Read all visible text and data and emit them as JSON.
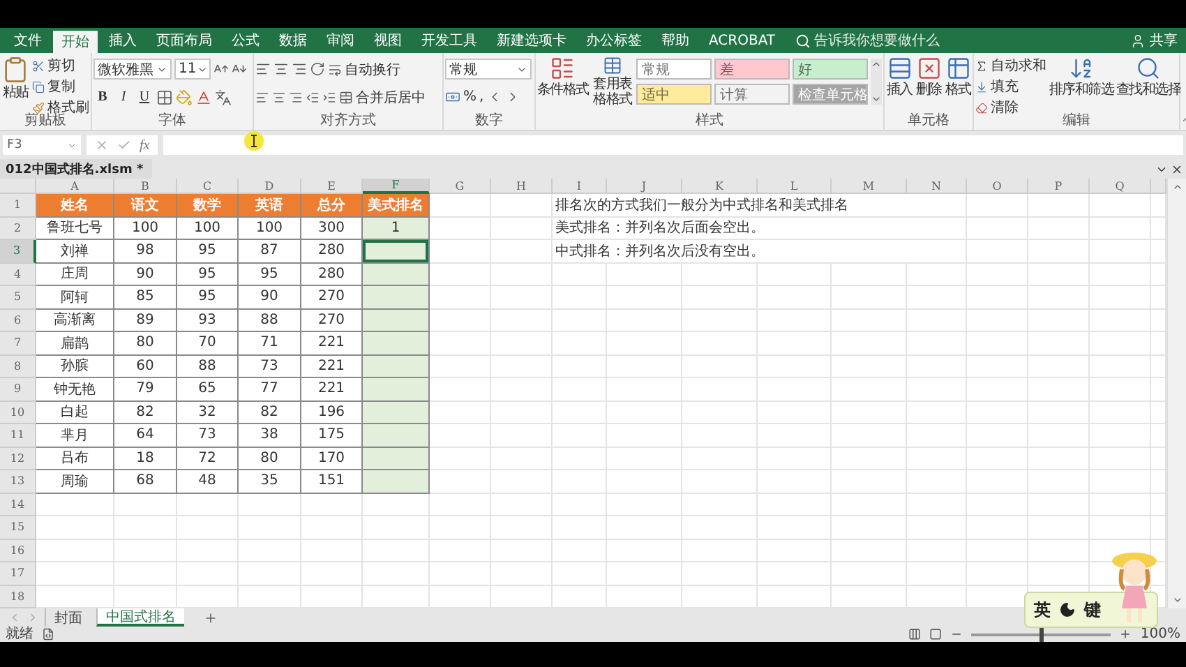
{
  "ribbon_tabs": [
    {
      "label": "文件",
      "selected": false
    },
    {
      "label": "开始",
      "selected": true
    },
    {
      "label": "插入",
      "selected": false
    },
    {
      "label": "页面布局",
      "selected": false
    },
    {
      "label": "公式",
      "selected": false
    },
    {
      "label": "数据",
      "selected": false
    },
    {
      "label": "审阅",
      "selected": false
    },
    {
      "label": "视图",
      "selected": false
    },
    {
      "label": "开发工具",
      "selected": false
    },
    {
      "label": "新建选项卡",
      "selected": false
    },
    {
      "label": "办公标签",
      "selected": false
    },
    {
      "label": "帮助",
      "selected": false
    },
    {
      "label": "ACROBAT",
      "selected": false
    }
  ],
  "tell_me": {
    "placeholder": "告诉我你想要做什么"
  },
  "share": "共享",
  "ribbon": {
    "clipboard": {
      "paste": "粘贴",
      "cut": "剪切",
      "copy": "复制",
      "format_painter": "格式刷",
      "label": "剪贴板"
    },
    "font": {
      "name": "微软雅黑",
      "size": "11",
      "bold": "B",
      "italic": "I",
      "underline": "U",
      "label": "字体"
    },
    "alignment": {
      "wrap": "自动换行",
      "merge": "合并后居中",
      "label": "对齐方式"
    },
    "number": {
      "format": "常规",
      "percent": "%",
      "comma": ",",
      "label": "数字"
    },
    "styles": {
      "conditional": "条件格式",
      "table": "套用表格格式",
      "label": "样式",
      "cell_styles": [
        {
          "label": "常规",
          "color": "#ffffff"
        },
        {
          "label": "差",
          "color": "#ffc7ce"
        },
        {
          "label": "好",
          "color": "#c6efce"
        },
        {
          "label": "适中",
          "color": "#ffeb9c"
        },
        {
          "label": "计算",
          "color": "#f2f2f2"
        },
        {
          "label": "检查单元格",
          "color": "#a5a5a5"
        }
      ]
    },
    "cells": {
      "insert": "插入",
      "delete": "删除",
      "format": "格式",
      "label": "单元格"
    },
    "editing": {
      "autosum": "自动求和",
      "fill": "填充",
      "clear": "清除",
      "sort": "排序和筛选",
      "find": "查找和选择",
      "label": "编辑"
    }
  },
  "formula_bar": {
    "name_box": "F3",
    "fx": "fx"
  },
  "workbook_tab": "012中国式排名.xlsm *",
  "columns": [
    {
      "letter": "A",
      "selected": false
    },
    {
      "letter": "B",
      "selected": false
    },
    {
      "letter": "C",
      "selected": false
    },
    {
      "letter": "D",
      "selected": false
    },
    {
      "letter": "E",
      "selected": false
    },
    {
      "letter": "F",
      "selected": true
    },
    {
      "letter": "G",
      "selected": false
    },
    {
      "letter": "H",
      "selected": false
    },
    {
      "letter": "I",
      "selected": false
    },
    {
      "letter": "J",
      "selected": false
    },
    {
      "letter": "K",
      "selected": false
    },
    {
      "letter": "L",
      "selected": false
    },
    {
      "letter": "M",
      "selected": false
    },
    {
      "letter": "N",
      "selected": false
    },
    {
      "letter": "O",
      "selected": false
    },
    {
      "letter": "P",
      "selected": false
    },
    {
      "letter": "Q",
      "selected": false
    }
  ],
  "rows": [
    {
      "number": "1",
      "kind": "header",
      "selected": false,
      "cells": [
        "姓名",
        "语文",
        "数学",
        "英语",
        "总分",
        "美式排名"
      ],
      "note": "排名次的方式我们一般分为中式排名和美式排名"
    },
    {
      "number": "2",
      "kind": "data",
      "selected": false,
      "cells": [
        "鲁班七号",
        "100",
        "100",
        "100",
        "300",
        "1"
      ],
      "note": "美式排名：并列名次后面会空出。"
    },
    {
      "number": "3",
      "kind": "data",
      "selected": true,
      "cells": [
        "刘禅",
        "98",
        "95",
        "87",
        "280"
      ],
      "note": "中式排名：并列名次后没有空出。"
    },
    {
      "number": "4",
      "kind": "data",
      "selected": false,
      "cells": [
        "庄周",
        "90",
        "95",
        "95",
        "280"
      ]
    },
    {
      "number": "5",
      "kind": "data",
      "selected": false,
      "cells": [
        "阿轲",
        "85",
        "95",
        "90",
        "270"
      ]
    },
    {
      "number": "6",
      "kind": "data",
      "selected": false,
      "cells": [
        "高渐离",
        "89",
        "93",
        "88",
        "270"
      ]
    },
    {
      "number": "7",
      "kind": "data",
      "selected": false,
      "cells": [
        "扁鹊",
        "80",
        "70",
        "71",
        "221"
      ]
    },
    {
      "number": "8",
      "kind": "data",
      "selected": false,
      "cells": [
        "孙膑",
        "60",
        "88",
        "73",
        "221"
      ]
    },
    {
      "number": "9",
      "kind": "data",
      "selected": false,
      "cells": [
        "钟无艳",
        "79",
        "65",
        "77",
        "221"
      ]
    },
    {
      "number": "10",
      "kind": "data",
      "selected": false,
      "cells": [
        "白起",
        "82",
        "32",
        "82",
        "196"
      ]
    },
    {
      "number": "11",
      "kind": "data",
      "selected": false,
      "cells": [
        "芈月",
        "64",
        "73",
        "38",
        "175"
      ]
    },
    {
      "number": "12",
      "kind": "data",
      "selected": false,
      "cells": [
        "吕布",
        "18",
        "72",
        "80",
        "170"
      ]
    },
    {
      "number": "13",
      "kind": "data",
      "selected": false,
      "cells": [
        "周瑜",
        "68",
        "48",
        "35",
        "151"
      ]
    },
    {
      "number": "14",
      "kind": "empty",
      "selected": false
    },
    {
      "number": "15",
      "kind": "empty",
      "selected": false
    },
    {
      "number": "16",
      "kind": "empty",
      "selected": false
    },
    {
      "number": "17",
      "kind": "empty",
      "selected": false
    },
    {
      "number": "18",
      "kind": "empty",
      "selected": false
    }
  ],
  "sheet_tabs": [
    {
      "label": "封面",
      "selected": false
    },
    {
      "label": "中国式排名",
      "selected": true
    }
  ],
  "ime": {
    "mode": "英",
    "label": "键"
  },
  "status_bar": {
    "status": "就绪",
    "zoom": {
      "level": 0.5,
      "reading": "100%"
    }
  }
}
